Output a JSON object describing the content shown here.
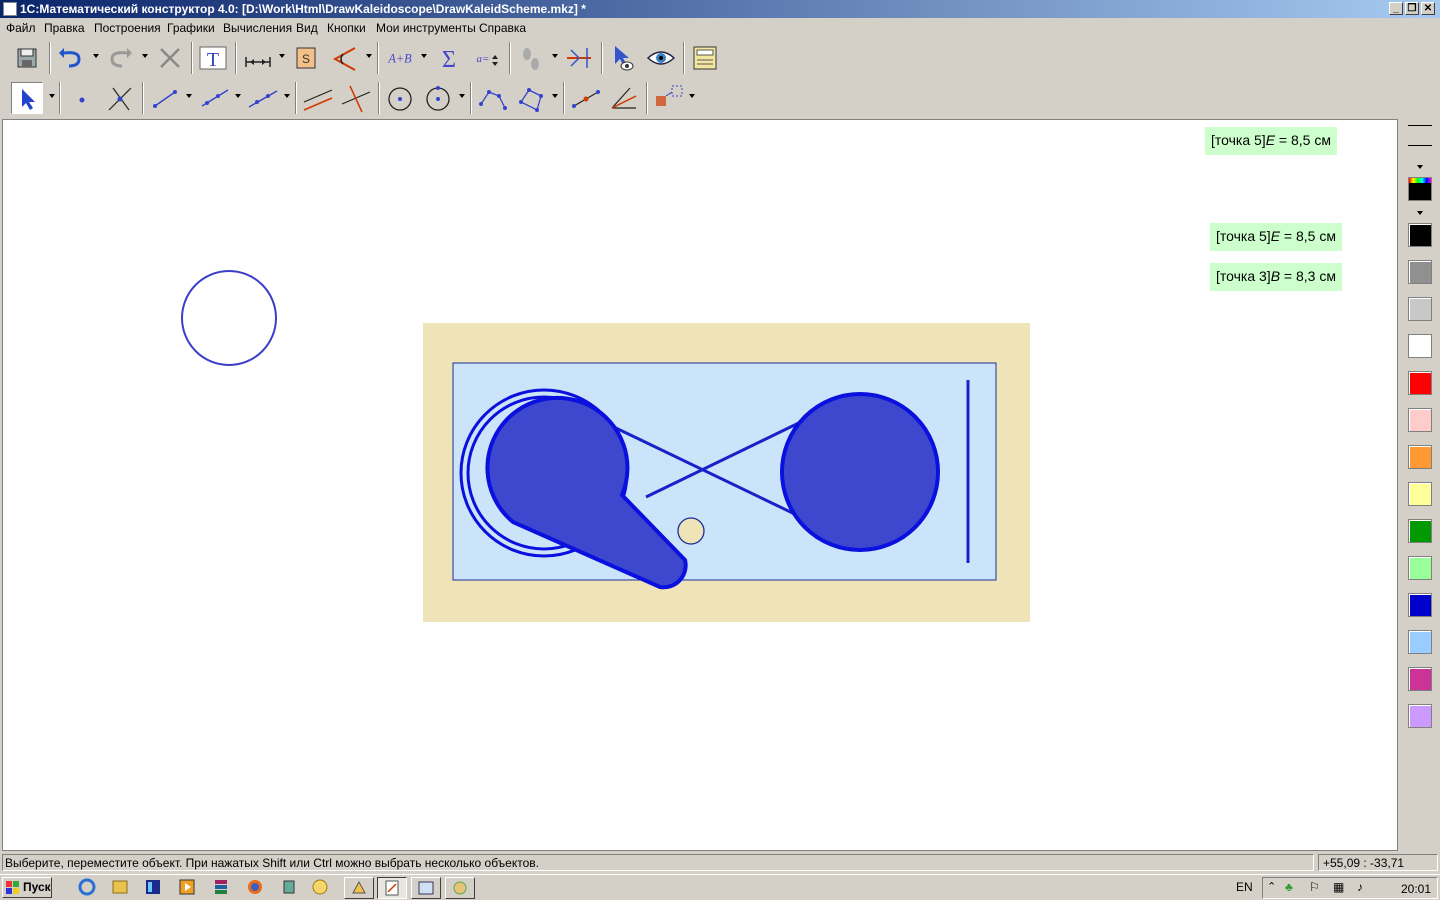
{
  "window": {
    "title": "1С:Математический конструктор 4.0: [D:\\Work\\Html\\DrawKaleidoscope\\DrawKaleidScheme.mkz] *",
    "buttons": [
      "_",
      "❐",
      "✕"
    ]
  },
  "menu": [
    "Файл",
    "Правка",
    "Построения",
    "Графики",
    "Вычисления",
    "Вид",
    "Кнопки",
    "Мои инструменты",
    "Справка"
  ],
  "toolbar1": {
    "text_tool": "T",
    "formula_tool": "A+B",
    "sum_tool": "Σ",
    "variable_tool": "a="
  },
  "canvas": {
    "labels": [
      {
        "prefix": "[точка 5]",
        "var": "E",
        "suffix": " = 8,5 см"
      },
      {
        "prefix": "[точка 5]",
        "var": "E",
        "suffix": " = 8,5 см"
      },
      {
        "prefix": "[точка 3]",
        "var": "B",
        "suffix": " = 8,3 см"
      }
    ]
  },
  "palette": {
    "colors": [
      "#000000",
      "#909090",
      "#c8c8c8",
      "#ffffff",
      "#ff0000",
      "#ffcccc",
      "#ff9933",
      "#ffff99",
      "#009900",
      "#99ff99",
      "#0000cc",
      "#99ccff",
      "#cc3399",
      "#cc99ff"
    ]
  },
  "status": {
    "text": "Выберите, переместите объект. При нажатых Shift или Ctrl можно выбрать несколько объектов.",
    "coords": "+55,09 : -33,71"
  },
  "taskbar": {
    "start": "Пуск",
    "lang": "EN",
    "time": "20:01"
  },
  "colors": {
    "scheme_background": "#efe4b8",
    "scheme_panel": "#cce4fa",
    "shape_fill": "#3e48cf",
    "shape_stroke": "#0a10dd",
    "circle_outline": "#3b3fc8"
  }
}
